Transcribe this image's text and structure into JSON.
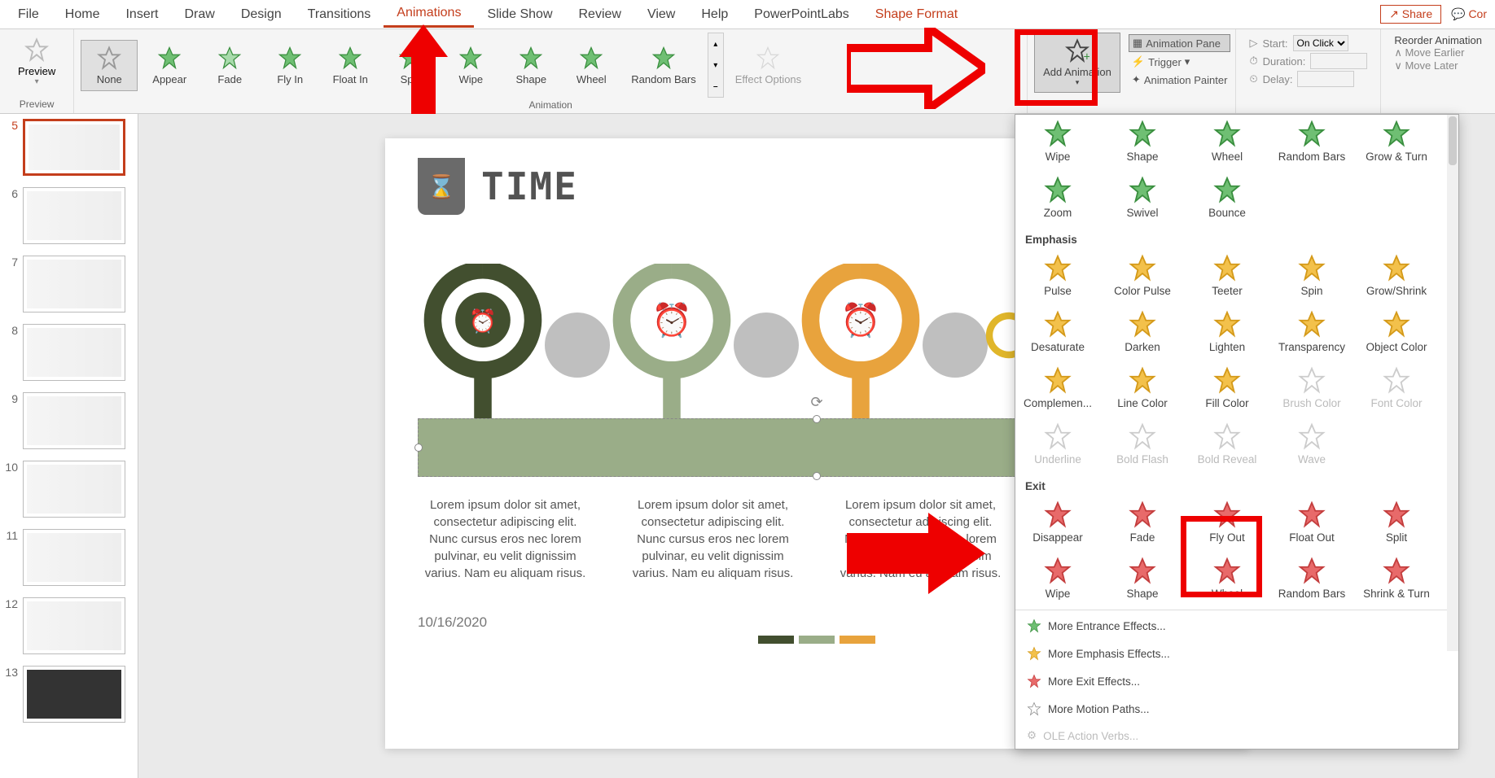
{
  "tabs": {
    "file": "File",
    "home": "Home",
    "insert": "Insert",
    "draw": "Draw",
    "design": "Design",
    "transitions": "Transitions",
    "animations": "Animations",
    "slideshow": "Slide Show",
    "review": "Review",
    "view": "View",
    "help": "Help",
    "pptlabs": "PowerPointLabs",
    "shapeformat": "Shape Format"
  },
  "share": "Share",
  "con": "Cor",
  "preview": {
    "label": "Preview",
    "group": "Preview"
  },
  "animGallery": {
    "none": "None",
    "appear": "Appear",
    "fade": "Fade",
    "flyin": "Fly In",
    "floatin": "Float In",
    "split": "Split",
    "wipe": "Wipe",
    "shape": "Shape",
    "wheel": "Wheel",
    "randombars": "Random Bars",
    "effectOptions": "Effect Options",
    "group": "Animation"
  },
  "advanced": {
    "addAnimation": "Add Animation",
    "animationPane": "Animation Pane",
    "trigger": "Trigger",
    "animationPainter": "Animation Painter"
  },
  "timing": {
    "start": "Start:",
    "startVal": "On Click",
    "duration": "Duration:",
    "delay": "Delay:"
  },
  "reorder": {
    "title": "Reorder Animation",
    "earlier": "Move Earlier",
    "later": "Move Later"
  },
  "thumbs": [
    "5",
    "6",
    "7",
    "8",
    "9",
    "10",
    "11",
    "12",
    "13"
  ],
  "slide": {
    "title": "TIME",
    "lorem": "Lorem ipsum dolor sit amet, consectetur adipiscing elit. Nunc cursus eros nec lorem pulvinar, eu velit dignissim varius. Nam eu aliquam risus.",
    "date": "10/16/2020"
  },
  "dropdown": {
    "entrance2": [
      "Wipe",
      "Shape",
      "Wheel",
      "Random Bars",
      "Grow & Turn",
      "Zoom",
      "Swivel",
      "Bounce"
    ],
    "emphasisLabel": "Emphasis",
    "emphasis": [
      "Pulse",
      "Color Pulse",
      "Teeter",
      "Spin",
      "Grow/Shrink",
      "Desaturate",
      "Darken",
      "Lighten",
      "Transparency",
      "Object Color",
      "Complemen...",
      "Line Color",
      "Fill Color",
      "Brush Color",
      "Font Color",
      "Underline",
      "Bold Flash",
      "Bold Reveal",
      "Wave"
    ],
    "exitLabel": "Exit",
    "exit": [
      "Disappear",
      "Fade",
      "Fly Out",
      "Float Out",
      "Split",
      "Wipe",
      "Shape",
      "Wheel",
      "Random Bars",
      "Shrink & Turn"
    ],
    "moreEntrance": "More Entrance Effects...",
    "moreEmphasis": "More Emphasis Effects...",
    "moreExit": "More Exit Effects...",
    "moreMotion": "More Motion Paths...",
    "ole": "OLE Action Verbs..."
  }
}
